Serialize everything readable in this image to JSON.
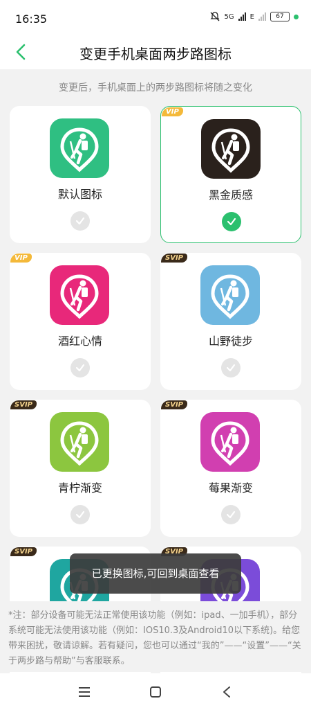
{
  "status": {
    "time": "16:35",
    "net": "5G",
    "net2": "E",
    "battery": "67"
  },
  "header": {
    "title": "变更手机桌面两步路图标"
  },
  "subtitle": "变更后，手机桌面上的两步路图标将随之变化",
  "icons": [
    {
      "name": "默认图标",
      "badge": "",
      "selected": false,
      "color": "#2fbf82"
    },
    {
      "name": "黑金质感",
      "badge": "VIP",
      "selected": true,
      "color": "#2a211c"
    },
    {
      "name": "酒红心情",
      "badge": "VIP",
      "selected": false,
      "color": "#e8287a"
    },
    {
      "name": "山野徒步",
      "badge": "SVIP",
      "selected": false,
      "color": "#6fb7e0"
    },
    {
      "name": "青柠渐变",
      "badge": "SVIP",
      "selected": false,
      "color": "#8cc63f"
    },
    {
      "name": "莓果渐变",
      "badge": "SVIP",
      "selected": false,
      "color": "#d13fb0"
    },
    {
      "name": "",
      "badge": "SVIP",
      "selected": false,
      "color": "#1fa6a0"
    },
    {
      "name": "",
      "badge": "SVIP",
      "selected": false,
      "color": "#7b4cd9"
    }
  ],
  "toast": "已更换图标,可回到桌面查看",
  "note": "*注：部分设备可能无法正常使用该功能（例如：ipad、一加手机），部分系统可能无法使用该功能（例如：IOS10.3及Android10以下系统)。给您带来困扰，敬请谅解。若有疑问，您也可以通过“我的”——“设置”——“关于两步路与帮助”与客服联系。"
}
